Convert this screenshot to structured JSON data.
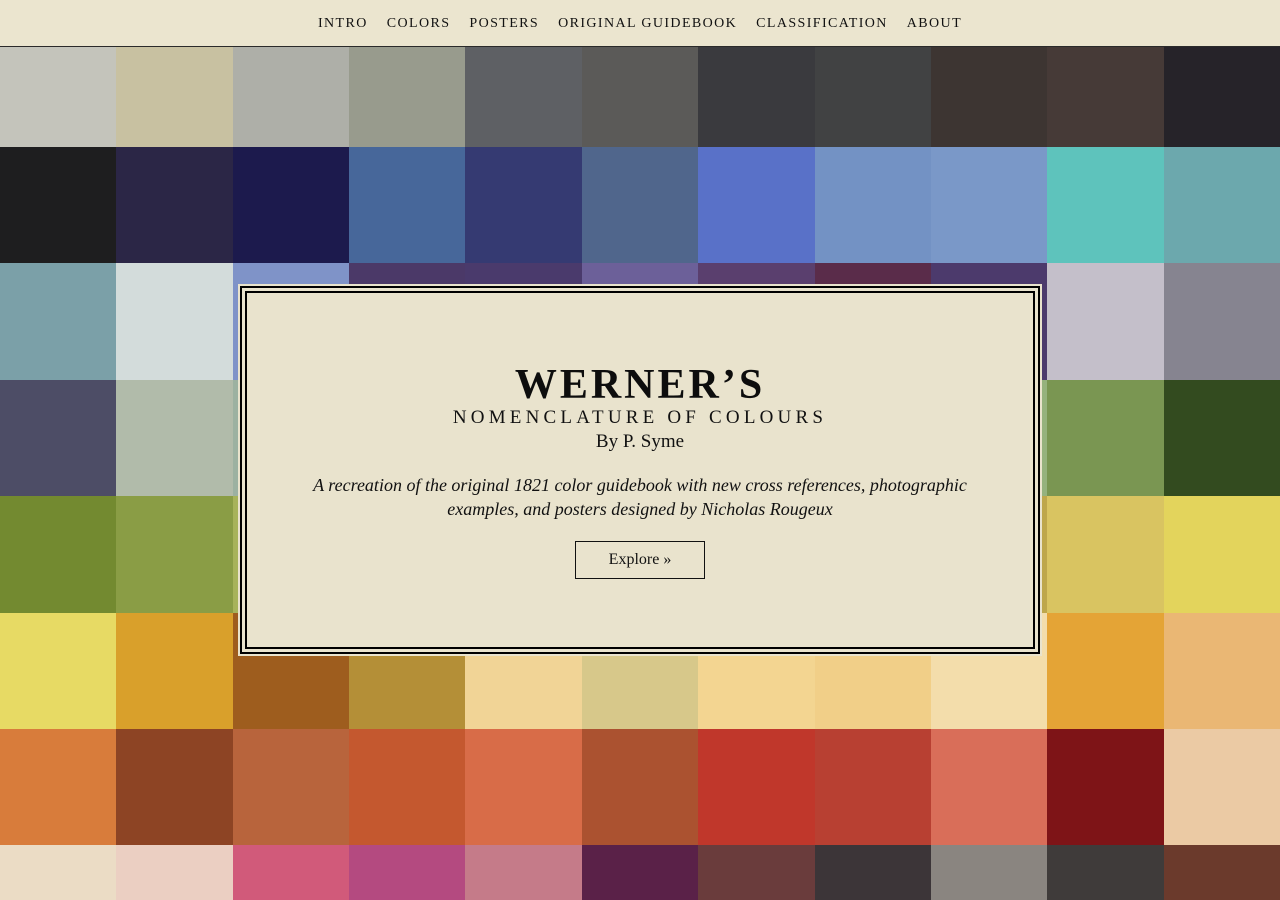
{
  "nav": {
    "items": [
      {
        "label": "INTRO"
      },
      {
        "label": "COLORS"
      },
      {
        "label": "POSTERS"
      },
      {
        "label": "ORIGINAL GUIDEBOOK"
      },
      {
        "label": "CLASSIFICATION"
      },
      {
        "label": "ABOUT"
      }
    ]
  },
  "hero": {
    "title": "WERNER’S",
    "subtitle": "NOMENCLATURE OF COLOURS",
    "author": "By P. Syme",
    "description": "A recreation of the original 1821 color guidebook with new cross references, photographic examples, and posters designed by Nicholas Rougeux",
    "explore_label": "Explore »"
  },
  "swatches": [
    [
      "#c4c4bb",
      "#c8c1a1",
      "#aeafa8",
      "#989b8d",
      "#5e6064",
      "#5b5a58",
      "#3a3a3e",
      "#414243",
      "#3d3532",
      "#463a37",
      "#262329"
    ],
    [
      "#1e1e1f",
      "#2b2646",
      "#1c1a4d",
      "#47679a",
      "#353a72",
      "#50668c",
      "#5971c8",
      "#7392c4",
      "#7a98c8",
      "#5ec3bc",
      "#6ca8ad"
    ],
    [
      "#7ba0a8",
      "#d3dcdb",
      "#7f93c8",
      "#4b3968",
      "#4a3a6c",
      "#6c6099",
      "#5a3f6e",
      "#5a2c4a",
      "#4c3a6c",
      "#c4bfca",
      "#868490"
    ],
    [
      "#4d4d66",
      "#b1bbaa",
      "#9cb1a1",
      "#9bb594",
      "#98b08e",
      "#8fad87",
      "#8eab80",
      "#97b58a",
      "#95b27d",
      "#7a9652",
      "#334b1f"
    ],
    [
      "#738a30",
      "#8a9d45",
      "#a7b35a",
      "#bcb968",
      "#c7c272",
      "#cfc77a",
      "#d4c882",
      "#cfc57b",
      "#bea74b",
      "#d9c461",
      "#e3d45c"
    ],
    [
      "#e7da64",
      "#d9a02b",
      "#9e5d1e",
      "#b48f37",
      "#f1d496",
      "#d7c88a",
      "#f3d591",
      "#f1cf88",
      "#f3ddab",
      "#e4a436",
      "#eab774"
    ],
    [
      "#d87c3b",
      "#8d4424",
      "#b8643c",
      "#c4582f",
      "#d86c48",
      "#ab5230",
      "#c0372b",
      "#b84032",
      "#d96e59",
      "#7e1417",
      "#ebcaa4"
    ],
    [
      "#ebdcc5",
      "#ebcfc2",
      "#d15a7a",
      "#b44a80",
      "#c57b89",
      "#5a2148",
      "#6a3c3c",
      "#3c3538",
      "#8a8580",
      "#3f3b3a",
      "#6b3a2c"
    ]
  ]
}
